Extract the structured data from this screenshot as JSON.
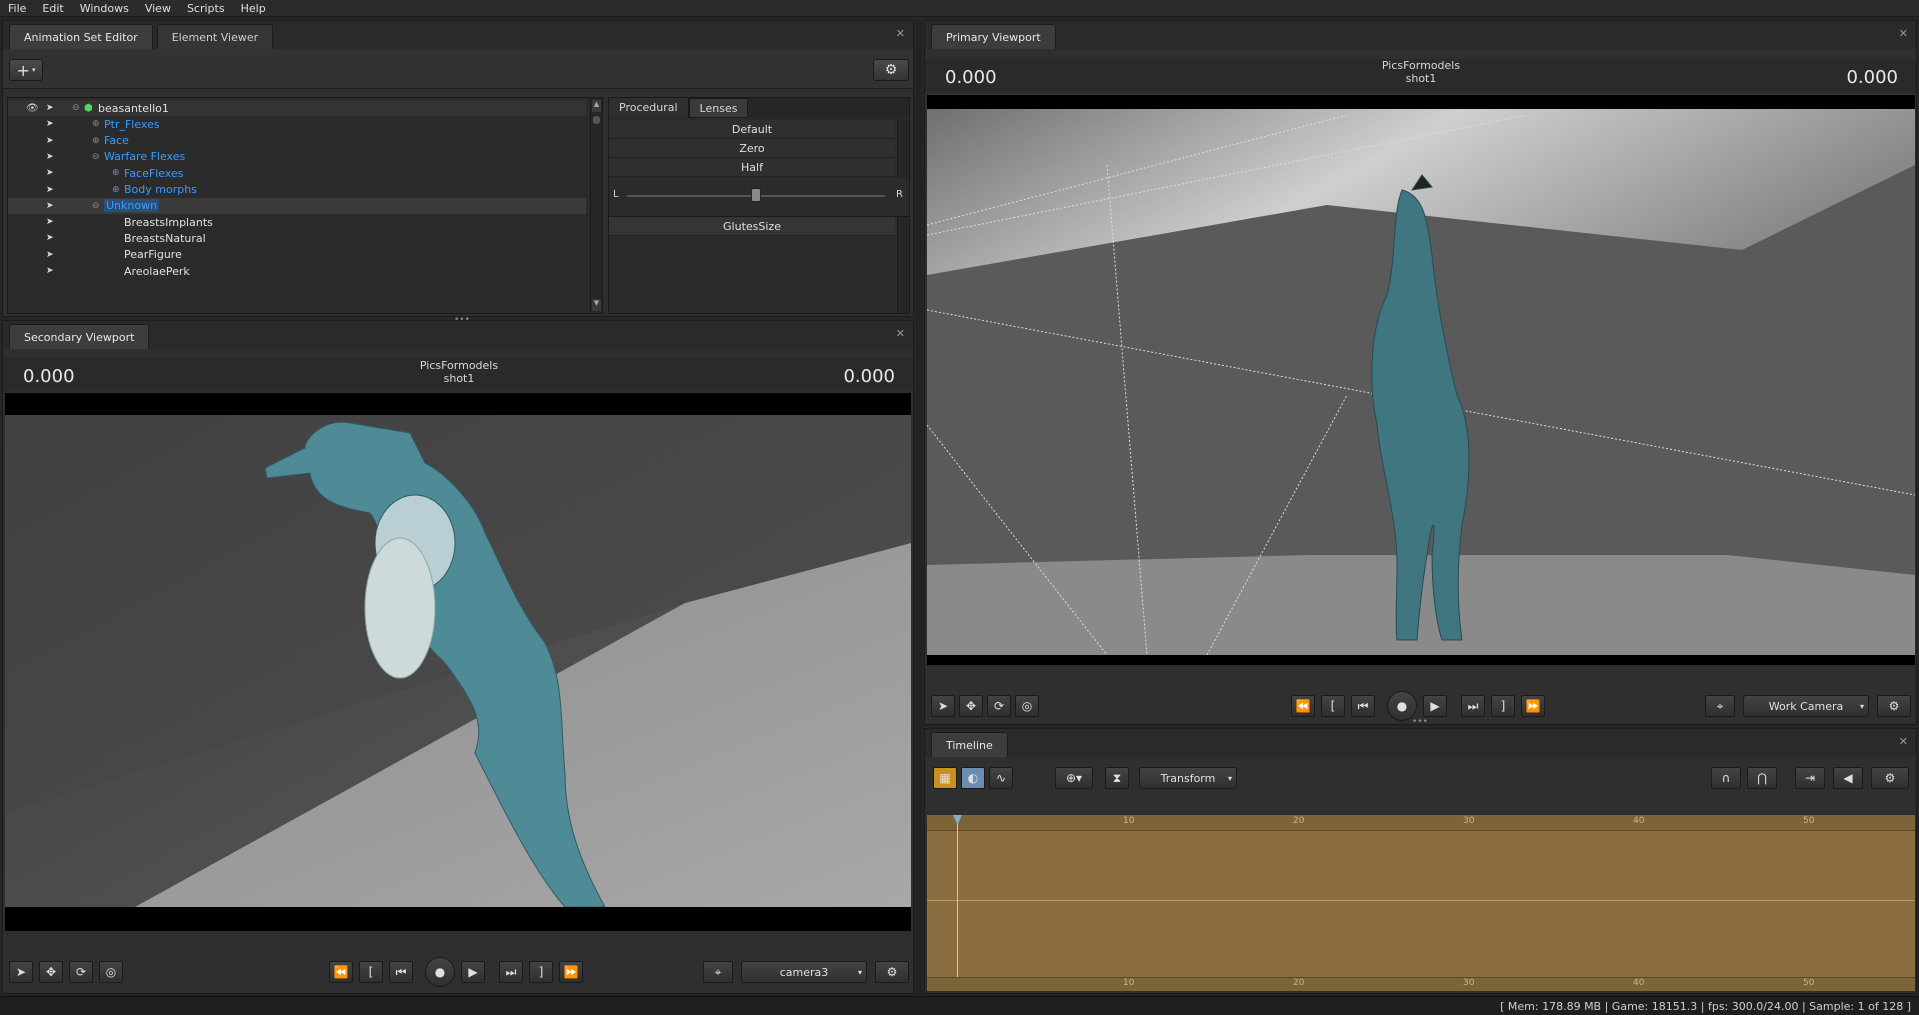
{
  "menu": [
    "File",
    "Edit",
    "Windows",
    "View",
    "Scripts",
    "Help"
  ],
  "anim_panel": {
    "tabs": [
      "Animation Set Editor",
      "Element Viewer"
    ],
    "add_label": "+",
    "tree": [
      {
        "label": "beasantello1",
        "indent": 0,
        "style": "white",
        "expand": "minus",
        "cube": true
      },
      {
        "label": "Ptr_Flexes",
        "indent": 1,
        "style": "link",
        "expand": "plus"
      },
      {
        "label": "Face",
        "indent": 1,
        "style": "link",
        "expand": "plus"
      },
      {
        "label": "Warfare Flexes",
        "indent": 1,
        "style": "link",
        "expand": "minus"
      },
      {
        "label": "FaceFlexes",
        "indent": 2,
        "style": "link",
        "expand": "plus"
      },
      {
        "label": "Body morphs",
        "indent": 2,
        "style": "link",
        "expand": "plus"
      },
      {
        "label": "Unknown",
        "indent": 1,
        "style": "link",
        "expand": "minus",
        "selected": true
      },
      {
        "label": "BreastsImplants",
        "indent": 2,
        "style": "white",
        "expand": ""
      },
      {
        "label": "BreastsNatural",
        "indent": 2,
        "style": "white",
        "expand": ""
      },
      {
        "label": "PearFigure",
        "indent": 2,
        "style": "white",
        "expand": ""
      },
      {
        "label": "AreolaePerk",
        "indent": 2,
        "style": "white",
        "expand": ""
      }
    ],
    "procedural_tabs": [
      "Procedural",
      "Lenses"
    ],
    "procedural_items": [
      "Default",
      "Zero",
      "Half"
    ],
    "slider_left": "L",
    "slider_right": "R",
    "slider_value": 0.5,
    "control_name": "GlutesSize"
  },
  "secondary_viewport": {
    "tab": "Secondary Viewport",
    "left_time": "0.000",
    "right_time": "0.000",
    "session": "PicsFormodels",
    "shot": "shot1",
    "camera": "camera3"
  },
  "primary_viewport": {
    "tab": "Primary Viewport",
    "left_time": "0.000",
    "right_time": "0.000",
    "session": "PicsFormodels",
    "shot": "shot1",
    "camera": "Work Camera"
  },
  "timeline": {
    "tab": "Timeline",
    "mode": "Transform",
    "ticks": [
      "10",
      "20",
      "30",
      "40",
      "50"
    ]
  },
  "status": {
    "mem_label": "[ Mem:",
    "mem_value": "178.89 MB",
    "game_label": "| Game:",
    "game_value": "18151.3",
    "fps_label": "| fps:",
    "fps_value": "300.0/24.00",
    "sample_label": "| Sample:",
    "sample_value": "1 of 128 ]"
  },
  "colors": {
    "link": "#3a9cff",
    "timeline": "#8a6e3f",
    "accent": "#e0a020"
  }
}
